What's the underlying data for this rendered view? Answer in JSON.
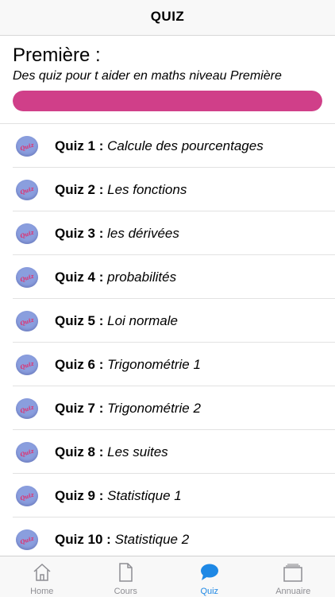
{
  "navbar": {
    "title": "QUIZ"
  },
  "header": {
    "title": "Première :",
    "subtitle": "Des quiz pour t aider en maths niveau Première",
    "progress": 1.0,
    "progress_color": "#d03f89"
  },
  "quizzes": [
    {
      "number": "Quiz 1 :",
      "topic": "Calcule des pourcentages",
      "icon_text": "Quiz"
    },
    {
      "number": "Quiz 2 :",
      "topic": "Les fonctions",
      "icon_text": "Quiz"
    },
    {
      "number": "Quiz 3 :",
      "topic": "les dérivées",
      "icon_text": "Quiz"
    },
    {
      "number": "Quiz 4 :",
      "topic": "probabilités",
      "icon_text": "Quiz"
    },
    {
      "number": "Quiz 5 :",
      "topic": "Loi normale",
      "icon_text": "Quiz"
    },
    {
      "number": "Quiz 6 :",
      "topic": "Trigonométrie 1",
      "icon_text": "Quiz"
    },
    {
      "number": "Quiz 7 :",
      "topic": "Trigonométrie 2",
      "icon_text": "Quiz"
    },
    {
      "number": "Quiz 8 :",
      "topic": "Les suites",
      "icon_text": "Quiz"
    },
    {
      "number": "Quiz 9 :",
      "topic": "Statistique 1",
      "icon_text": "Quiz"
    },
    {
      "number": "Quiz 10 :",
      "topic": "Statistique 2",
      "icon_text": "Quiz"
    }
  ],
  "tabbar": {
    "active_color": "#1e88e5",
    "tabs": [
      {
        "label": "Home",
        "icon": "home-icon"
      },
      {
        "label": "Cours",
        "icon": "document-icon"
      },
      {
        "label": "Quiz",
        "icon": "chat-bubble-icon",
        "active": true
      },
      {
        "label": "Annuaire",
        "icon": "cards-icon"
      }
    ]
  }
}
